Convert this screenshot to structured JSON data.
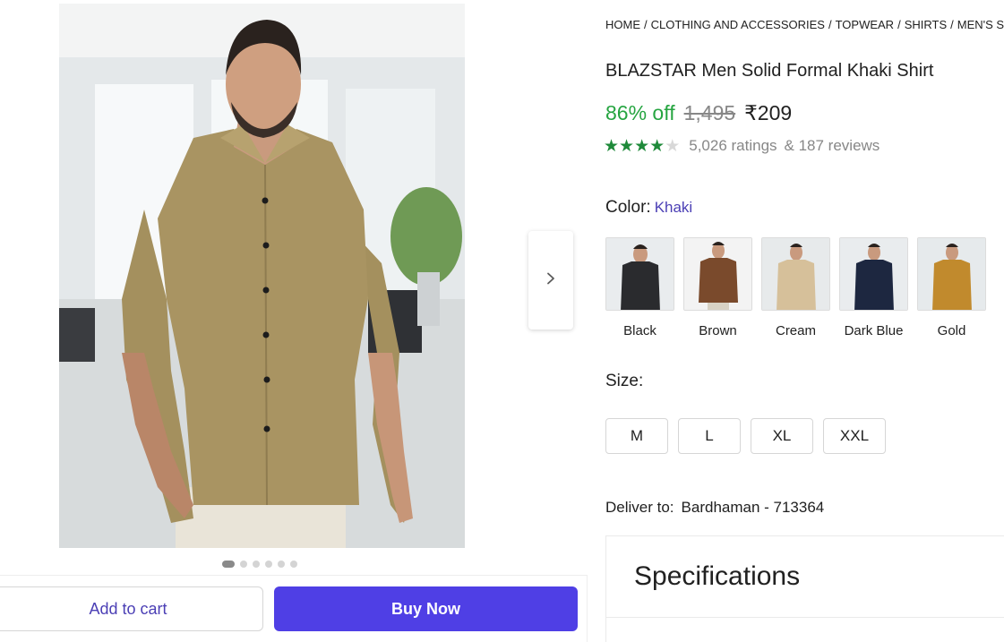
{
  "breadcrumb": [
    "HOME",
    "CLOTHING AND ACCESSORIES",
    "TOPWEAR",
    "SHIRTS",
    "MEN'S SHIRTS"
  ],
  "product": {
    "title": "BLAZSTAR Men Solid Formal Khaki Shirt",
    "discount": "86% off",
    "mrp": "1,495",
    "price": "₹209",
    "rating": 4,
    "ratings_count": "5,026 ratings",
    "reviews_count": "& 187 reviews"
  },
  "color": {
    "label": "Color:",
    "selected": "Khaki",
    "options": [
      {
        "name": "Black",
        "hex": "#2a2b2e"
      },
      {
        "name": "Brown",
        "hex": "#7a4a2c"
      },
      {
        "name": "Cream",
        "hex": "#d6c09a"
      },
      {
        "name": "Dark Blue",
        "hex": "#1d2740"
      },
      {
        "name": "Gold",
        "hex": "#c18a2d"
      }
    ]
  },
  "size": {
    "label": "Size:",
    "options": [
      "M",
      "L",
      "XL",
      "XXL"
    ]
  },
  "delivery": {
    "label": "Deliver to:",
    "location": "Bardhaman - 713364"
  },
  "specifications": {
    "title": "Specifications"
  },
  "actions": {
    "add_to_cart": "Add to cart",
    "buy_now": "Buy Now"
  },
  "gallery": {
    "image_count": 6,
    "active_index": 0
  },
  "icons": {
    "next": "chevron-right-icon",
    "star": "star-icon"
  },
  "colors": {
    "accent": "#4f3fe5",
    "discount_green": "#26a541",
    "rating_green": "#1f8a3a",
    "shirt_khaki": "#a99462"
  }
}
